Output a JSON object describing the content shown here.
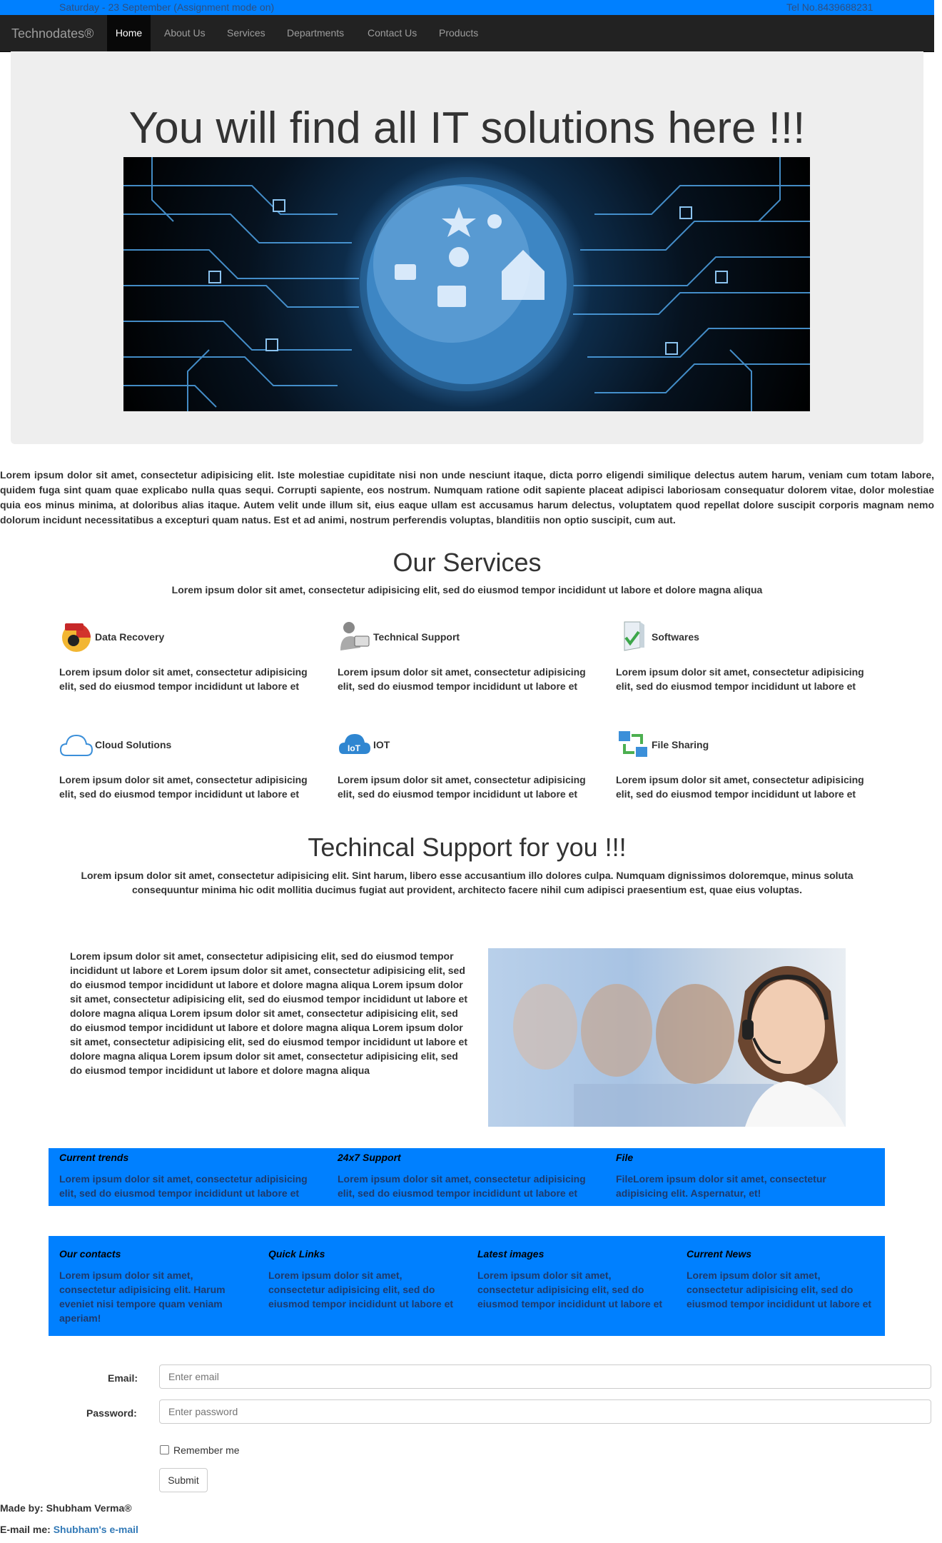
{
  "topbar": {
    "date": "Saturday - 23 September (Assignment mode on)",
    "tel": "Tel No.8439688231"
  },
  "navbar": {
    "brand": "Technodates®",
    "items": [
      {
        "label": "Home",
        "active": true
      },
      {
        "label": "About Us"
      },
      {
        "label": "Services"
      },
      {
        "label": "Departments"
      },
      {
        "label": "Contact Us"
      },
      {
        "label": "Products"
      }
    ]
  },
  "hero": {
    "title": "You will find all IT solutions here !!!"
  },
  "intro": "Lorem ipsum dolor sit amet, consectetur adipisicing elit. Iste molestiae cupiditate nisi non unde nesciunt itaque, dicta porro eligendi similique delectus autem harum, veniam cum totam labore, quidem fuga sint quam quae explicabo nulla quas sequi. Corrupti sapiente, eos nostrum. Numquam ratione odit sapiente placeat adipisci laboriosam consequatur dolorem vitae, dolor molestiae quia eos minus minima, at doloribus alias itaque. Autem velit unde illum sit, eius eaque ullam est accusamus harum delectus, voluptatem quod repellat dolore suscipit corporis magnam nemo dolorum incidunt necessitatibus a excepturi quam natus. Est et ad animi, nostrum perferendis voluptas, blanditiis non optio suscipit, cum aut.",
  "services": {
    "title": "Our Services",
    "subtitle": "Lorem ipsum dolor sit amet, consectetur adipisicing elit, sed do eiusmod tempor incididunt ut labore et dolore magna aliqua",
    "items": [
      {
        "name": "Data Recovery",
        "icon": "data-recovery-icon",
        "desc": "Lorem ipsum dolor sit amet, consectetur adipisicing elit, sed do eiusmod tempor incididunt ut labore et"
      },
      {
        "name": "Technical Support",
        "icon": "technical-support-icon",
        "desc": "Lorem ipsum dolor sit amet, consectetur adipisicing elit, sed do eiusmod tempor incididunt ut labore et"
      },
      {
        "name": "Softwares",
        "icon": "software-box-icon",
        "desc": "Lorem ipsum dolor sit amet, consectetur adipisicing elit, sed do eiusmod tempor incididunt ut labore et"
      },
      {
        "name": "Cloud Solutions",
        "icon": "cloud-icon",
        "desc": "Lorem ipsum dolor sit amet, consectetur adipisicing elit, sed do eiusmod tempor incididunt ut labore et"
      },
      {
        "name": "IOT",
        "icon": "iot-icon",
        "desc": "Lorem ipsum dolor sit amet, consectetur adipisicing elit, sed do eiusmod tempor incididunt ut labore et"
      },
      {
        "name": "File Sharing",
        "icon": "file-sharing-icon",
        "desc": "Lorem ipsum dolor sit amet, consectetur adipisicing elit, sed do eiusmod tempor incididunt ut labore et"
      }
    ]
  },
  "support": {
    "title": "Techincal Support for you !!!",
    "subtitle": "Lorem ipsum dolor sit amet, consectetur adipisicing elit. Sint harum, libero esse accusantium illo dolores culpa. Numquam dignissimos doloremque, minus soluta consequuntur minima hic odit mollitia ducimus fugiat aut provident, architecto facere nihil cum adipisci praesentium est, quae eius voluptas.",
    "body": "Lorem ipsum dolor sit amet, consectetur adipisicing elit, sed do eiusmod tempor incididunt ut labore et Lorem ipsum dolor sit amet, consectetur adipisicing elit, sed do eiusmod tempor incididunt ut labore et dolore magna aliqua Lorem ipsum dolor sit amet, consectetur adipisicing elit, sed do eiusmod tempor incididunt ut labore et dolore magna aliqua Lorem ipsum dolor sit amet, consectetur adipisicing elit, sed do eiusmod tempor incididunt ut labore et dolore magna aliqua Lorem ipsum dolor sit amet, consectetur adipisicing elit, sed do eiusmod tempor incididunt ut labore et dolore magna aliqua Lorem ipsum dolor sit amet, consectetur adipisicing elit, sed do eiusmod tempor incididunt ut labore et dolore magna aliqua"
  },
  "features": [
    {
      "title": "Current trends",
      "text": "Lorem ipsum dolor sit amet, consectetur adipisicing elit, sed do eiusmod tempor incididunt ut labore et"
    },
    {
      "title": "24x7 Support",
      "text": "Lorem ipsum dolor sit amet, consectetur adipisicing elit, sed do eiusmod tempor incididunt ut labore et"
    },
    {
      "title": "File",
      "text": "FileLorem ipsum dolor sit amet, consectetur adipisicing elit. Aspernatur, et!"
    }
  ],
  "footer_cols": [
    {
      "title": "Our contacts",
      "text": "Lorem ipsum dolor sit amet, consectetur adipisicing elit. Harum eveniet nisi tempore quam veniam aperiam!"
    },
    {
      "title": "Quick Links",
      "text": "Lorem ipsum dolor sit amet, consectetur adipisicing elit, sed do eiusmod tempor incididunt ut labore et"
    },
    {
      "title": "Latest images",
      "text": "Lorem ipsum dolor sit amet, consectetur adipisicing elit, sed do eiusmod tempor incididunt ut labore et"
    },
    {
      "title": "Current News",
      "text": "Lorem ipsum dolor sit amet, consectetur adipisicing elit, sed do eiusmod tempor incididunt ut labore et"
    }
  ],
  "form": {
    "email_label": "Email:",
    "email_placeholder": "Enter email",
    "password_label": "Password:",
    "password_placeholder": "Enter password",
    "remember_label": "Remember me",
    "submit_label": "Submit"
  },
  "credits": {
    "made_by_label": "Made by: Shubham Verma®",
    "email_label": "E-mail me:",
    "email_link": "Shubham's e-mail"
  },
  "colors": {
    "accent": "#0080ff",
    "navbar": "#222222",
    "hero_bg": "#eeeeee",
    "link": "#337ab7"
  }
}
